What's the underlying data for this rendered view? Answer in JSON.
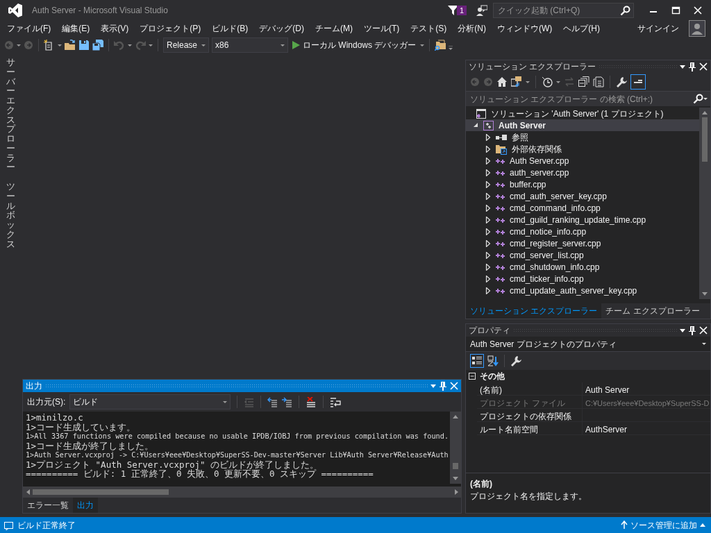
{
  "window": {
    "title": "Auth Server - Microsoft Visual Studio"
  },
  "notifications": {
    "count": "1"
  },
  "quick_launch": {
    "placeholder": "クイック起動 (Ctrl+Q)"
  },
  "menu": [
    "ファイル(F)",
    "編集(E)",
    "表示(V)",
    "プロジェクト(P)",
    "ビルド(B)",
    "デバッグ(D)",
    "チーム(M)",
    "ツール(T)",
    "テスト(S)",
    "分析(N)",
    "ウィンドウ(W)",
    "ヘルプ(H)"
  ],
  "account": {
    "sign_in": "サインイン"
  },
  "toolbar": {
    "configuration": "Release",
    "platform": "x86",
    "debugger": "ローカル Windows デバッガー"
  },
  "side_tabs": [
    "サーバーエクスプローラー",
    "ツールボックス"
  ],
  "output": {
    "title": "出力",
    "active": true,
    "source_label": "出力元(S):",
    "source": "ビルド",
    "lines": [
      "1>minilzo.c",
      "1>コード生成しています。",
      "1>All 3367 functions were compiled because no usable IPDB/IOBJ from previous compilation was found.",
      "1>コード生成が終了しました。",
      "1>Auth Server.vcxproj -> C:¥Users¥eee¥Desktop¥SuperSS-Dev-master¥Server Lib¥Auth Server¥Release¥Auth",
      "1>プロジェクト \"Auth Server.vcxproj\" のビルドが終了しました。",
      "========== ビルド: 1 正常終了、0 失敗、0 更新不要、0 スキップ =========="
    ],
    "tabs": [
      {
        "label": "エラー一覧",
        "selected": false
      },
      {
        "label": "出力",
        "selected": true
      }
    ]
  },
  "solution_explorer": {
    "title": "ソリューション エクスプローラー",
    "active": false,
    "search_placeholder": "ソリューション エクスプローラー の検索 (Ctrl+:)",
    "tree": [
      {
        "label": "ソリューション 'Auth Server' (1 プロジェクト)",
        "kind": "solution",
        "selected": false,
        "children": [
          {
            "label": "Auth Server",
            "kind": "project",
            "expanded": true,
            "selected": true,
            "children": [
              {
                "label": "参照",
                "kind": "references",
                "expanded": false,
                "selected": false
              },
              {
                "label": "外部依存関係",
                "kind": "dependencies",
                "expanded": false,
                "selected": false
              },
              {
                "label": "Auth Server.cpp",
                "kind": "cpp",
                "expanded": false,
                "selected": false
              },
              {
                "label": "auth_server.cpp",
                "kind": "cpp",
                "expanded": false,
                "selected": false
              },
              {
                "label": "buffer.cpp",
                "kind": "cpp",
                "expanded": false,
                "selected": false
              },
              {
                "label": "cmd_auth_server_key.cpp",
                "kind": "cpp",
                "expanded": false,
                "selected": false
              },
              {
                "label": "cmd_command_info.cpp",
                "kind": "cpp",
                "expanded": false,
                "selected": false
              },
              {
                "label": "cmd_guild_ranking_update_time.cpp",
                "kind": "cpp",
                "expanded": false,
                "selected": false
              },
              {
                "label": "cmd_notice_info.cpp",
                "kind": "cpp",
                "expanded": false,
                "selected": false
              },
              {
                "label": "cmd_register_server.cpp",
                "kind": "cpp",
                "expanded": false,
                "selected": false
              },
              {
                "label": "cmd_server_list.cpp",
                "kind": "cpp",
                "expanded": false,
                "selected": false
              },
              {
                "label": "cmd_shutdown_info.cpp",
                "kind": "cpp",
                "expanded": false,
                "selected": false
              },
              {
                "label": "cmd_ticker_info.cpp",
                "kind": "cpp",
                "expanded": false,
                "selected": false
              },
              {
                "label": "cmd_update_auth_server_key.cpp",
                "kind": "cpp",
                "expanded": false,
                "selected": false
              }
            ]
          }
        ]
      }
    ],
    "tabs": [
      {
        "label": "ソリューション エクスプローラー",
        "selected": true
      },
      {
        "label": "チーム エクスプローラー",
        "selected": false
      }
    ]
  },
  "properties": {
    "title": "プロパティ",
    "active": false,
    "object": "Auth Server プロジェクトのプロパティ",
    "category": {
      "label": "その他",
      "expanded": true
    },
    "rows": [
      {
        "name": "(名前)",
        "value": "Auth Server",
        "disabled": false
      },
      {
        "name": "プロジェクト ファイル",
        "value": "C:¥Users¥eee¥Desktop¥SuperSS-D",
        "disabled": true
      },
      {
        "name": "プロジェクトの依存関係",
        "value": "",
        "disabled": false
      },
      {
        "name": "ルート名前空間",
        "value": "AuthServer",
        "disabled": false
      }
    ],
    "description": {
      "title": "(名前)",
      "text": "プロジェクト名を指定します。"
    }
  },
  "status_bar": {
    "message": "ビルド正常終了",
    "source_control": "ソース管理に追加"
  }
}
